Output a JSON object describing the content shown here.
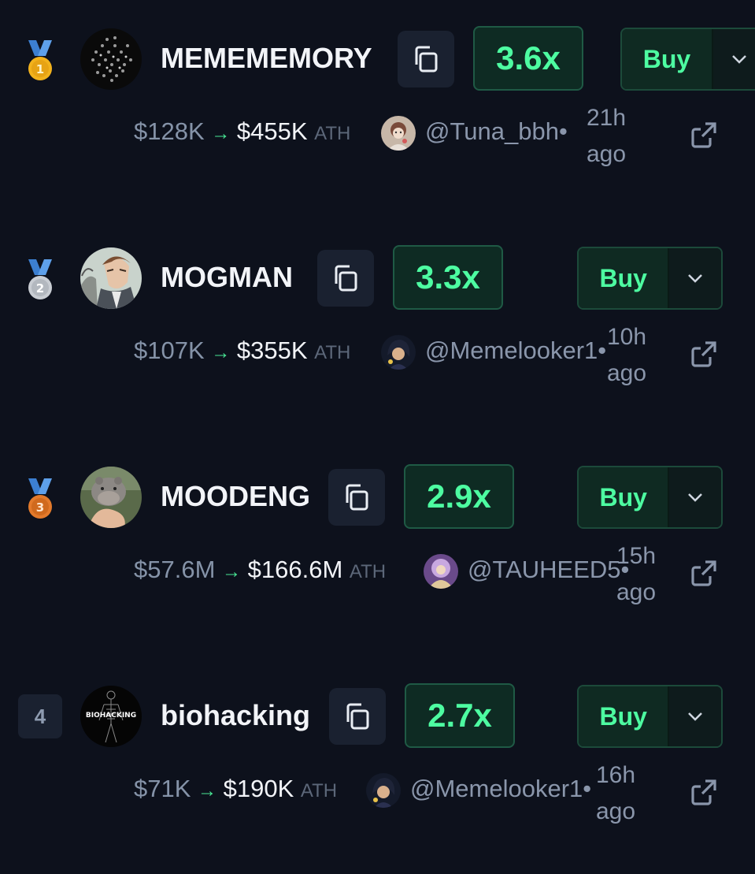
{
  "rows": [
    {
      "rank": "1",
      "rank_type": "gold-medal",
      "name": "MEMEMEMORY",
      "multiplier": "3.6x",
      "buy_label": "Buy",
      "mc_from": "$128K",
      "mc_to": "$455K",
      "ath_label": "ATH",
      "caller": "@Tuna_bbh",
      "separator": "•",
      "time_top": "21h",
      "time_bottom": "ago"
    },
    {
      "rank": "2",
      "rank_type": "silver-medal",
      "name": "MOGMAN",
      "multiplier": "3.3x",
      "buy_label": "Buy",
      "mc_from": "$107K",
      "mc_to": "$355K",
      "ath_label": "ATH",
      "caller": "@Memelooker1",
      "separator": "•",
      "time_top": "10h",
      "time_bottom": "ago"
    },
    {
      "rank": "3",
      "rank_type": "bronze-medal",
      "name": "MOODENG",
      "multiplier": "2.9x",
      "buy_label": "Buy",
      "mc_from": "$57.6M",
      "mc_to": "$166.6M",
      "ath_label": "ATH",
      "caller": "@TAUHEED5",
      "separator": "•",
      "time_top": "15h",
      "time_bottom": "ago"
    },
    {
      "rank": "4",
      "rank_type": "number",
      "name": "biohacking",
      "avatar_text": "BIOHACKING",
      "multiplier": "2.7x",
      "buy_label": "Buy",
      "mc_from": "$71K",
      "mc_to": "$190K",
      "ath_label": "ATH",
      "caller": "@Memelooker1",
      "separator": "•",
      "time_top": "16h",
      "time_bottom": "ago"
    }
  ],
  "arrow_glyph": "→",
  "icons": {
    "copy": "copy-icon",
    "dropdown": "chevron-down-icon",
    "external": "external-link-icon",
    "medal": "medal-icon"
  },
  "colors": {
    "background": "#0d111c",
    "accent_green": "#4dfca1",
    "button_dark": "#1a2130",
    "gold": "#f2b21c",
    "silver": "#c9cdd3",
    "bronze": "#e37a2b",
    "ribbon_blue": "#3c7fd1"
  }
}
